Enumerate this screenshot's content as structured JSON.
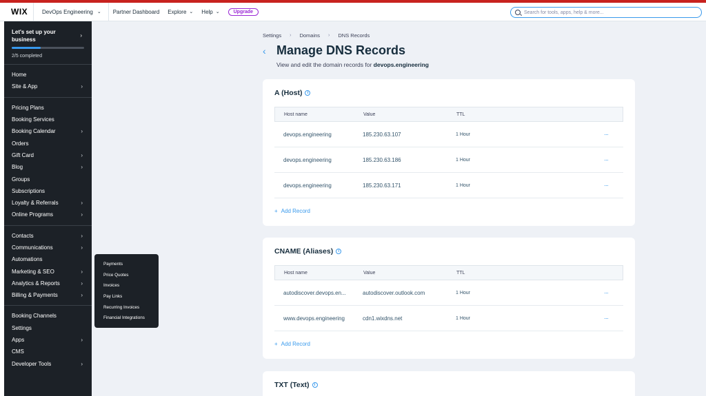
{
  "topbar": {
    "logo": "WIX",
    "site_name": "DevOps Engineering",
    "nav": [
      "Partner Dashboard",
      "Explore",
      "Help"
    ],
    "upgrade": "Upgrade",
    "search_placeholder": "Search for tools, apps, help & more..."
  },
  "sidebar": {
    "setup_title": "Let's set up your business",
    "setup_progress": 0.4,
    "setup_count": "2/5 completed",
    "groups": [
      [
        {
          "label": "Home",
          "arrow": false
        },
        {
          "label": "Site & App",
          "arrow": true
        }
      ],
      [
        {
          "label": "Pricing Plans",
          "arrow": false
        },
        {
          "label": "Booking Services",
          "arrow": false
        },
        {
          "label": "Booking Calendar",
          "arrow": true
        },
        {
          "label": "Orders",
          "arrow": false
        },
        {
          "label": "Gift Card",
          "arrow": true
        },
        {
          "label": "Blog",
          "arrow": true
        },
        {
          "label": "Groups",
          "arrow": false
        },
        {
          "label": "Subscriptions",
          "arrow": false
        },
        {
          "label": "Loyalty & Referrals",
          "arrow": true
        },
        {
          "label": "Online Programs",
          "arrow": true
        }
      ],
      [
        {
          "label": "Contacts",
          "arrow": true
        },
        {
          "label": "Communications",
          "arrow": true
        },
        {
          "label": "Automations",
          "arrow": false
        },
        {
          "label": "Marketing & SEO",
          "arrow": true
        },
        {
          "label": "Analytics & Reports",
          "arrow": true
        },
        {
          "label": "Billing & Payments",
          "arrow": true
        }
      ],
      [
        {
          "label": "Booking Channels",
          "arrow": false
        },
        {
          "label": "Settings",
          "arrow": false
        },
        {
          "label": "Apps",
          "arrow": true
        },
        {
          "label": "CMS",
          "arrow": false
        },
        {
          "label": "Developer Tools",
          "arrow": true
        }
      ]
    ]
  },
  "flyout": [
    "Payments",
    "Price Quotes",
    "Invoices",
    "Pay Links",
    "Recurring Invoices",
    "Financial Integrations"
  ],
  "breadcrumb": [
    "Settings",
    "Domains",
    "DNS Records"
  ],
  "page": {
    "title": "Manage DNS Records",
    "subtitle_prefix": "View and edit the domain records for",
    "domain": "devops.engineering"
  },
  "columns": [
    "Host name",
    "Value",
    "TTL"
  ],
  "a_records": {
    "title": "A (Host)",
    "rows": [
      [
        "devops.engineering",
        "185.230.63.107",
        "1 Hour"
      ],
      [
        "devops.engineering",
        "185.230.63.186",
        "1 Hour"
      ],
      [
        "devops.engineering",
        "185.230.63.171",
        "1 Hour"
      ]
    ],
    "add_label": "Add Record"
  },
  "cname_records": {
    "title": "CNAME (Aliases)",
    "rows": [
      [
        "autodiscover.devops.en...",
        "autodiscover.outlook.com",
        "1 Hour"
      ],
      [
        "www.devops.engineering",
        "cdn1.wixdns.net",
        "1 Hour"
      ]
    ],
    "add_label": "Add Record"
  },
  "txt_records": {
    "title": "TXT (Text)"
  },
  "row_menu": "···",
  "info_glyph": "i"
}
